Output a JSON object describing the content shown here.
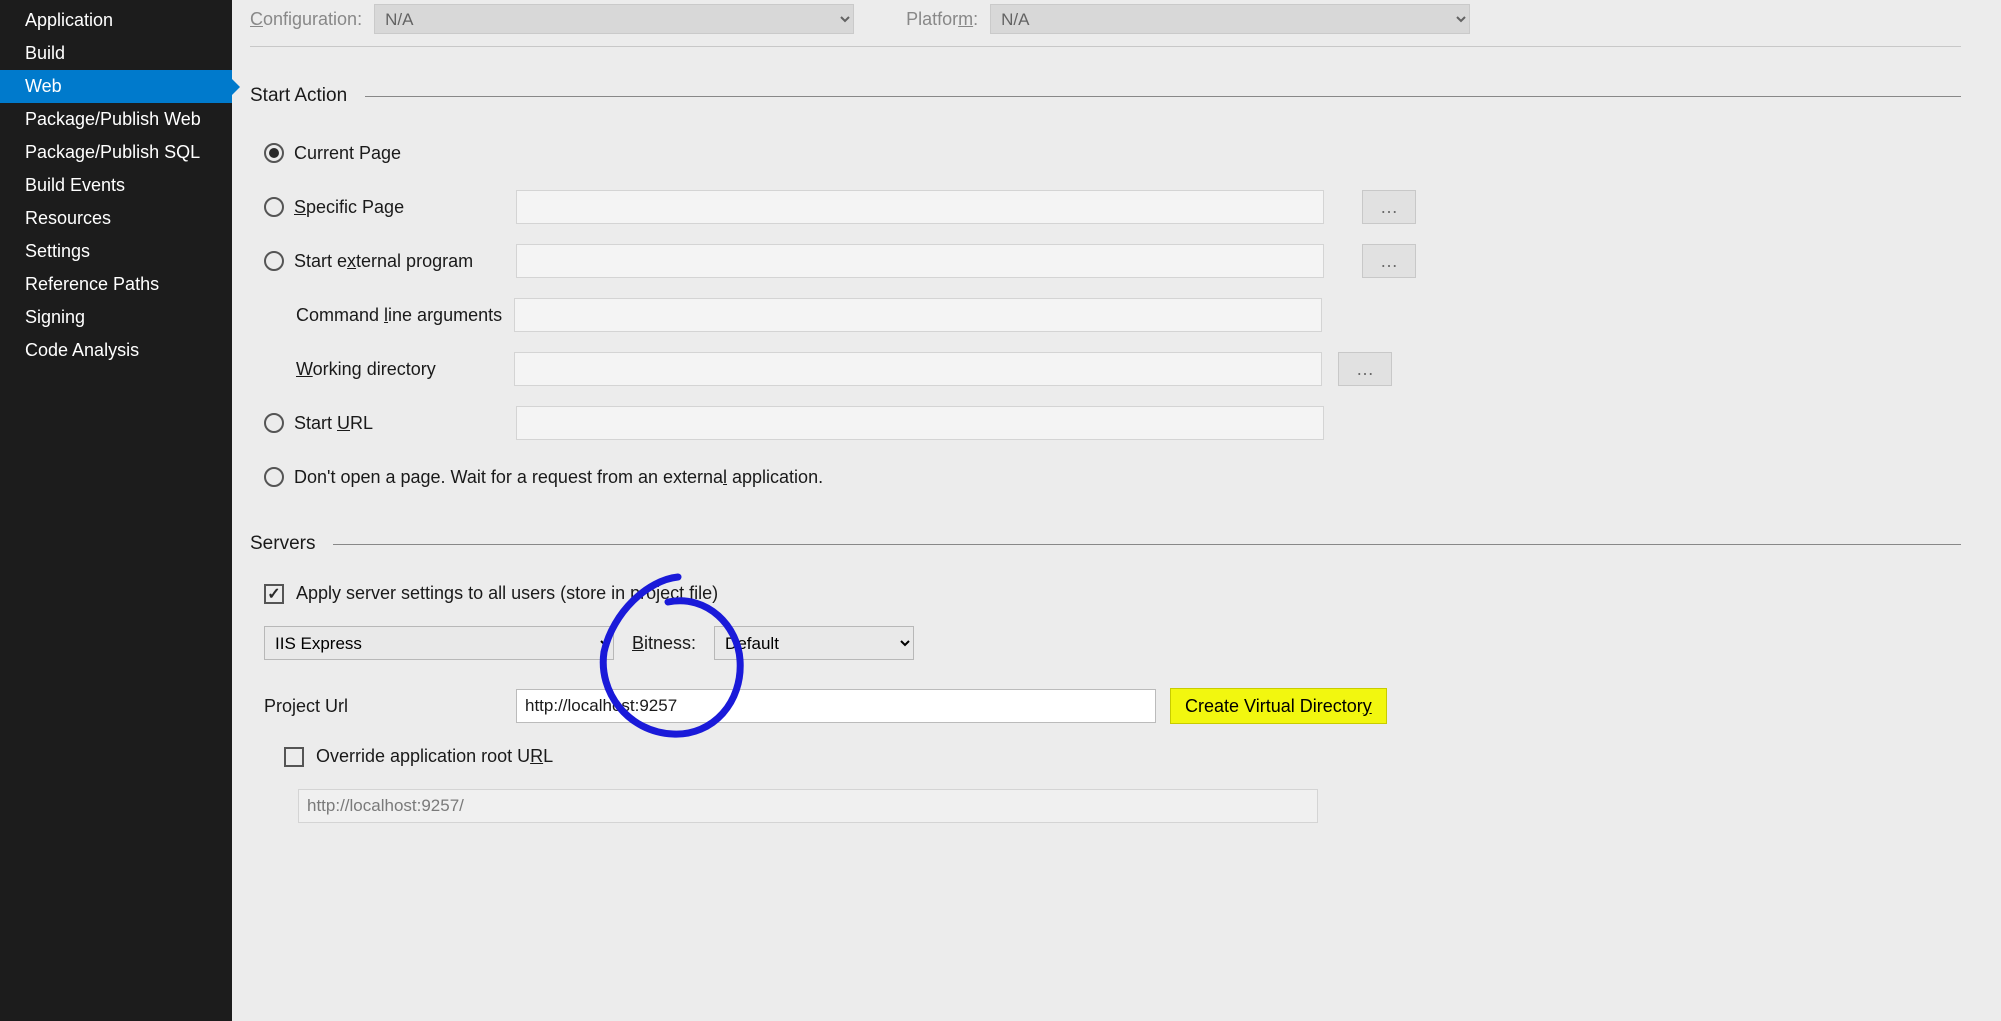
{
  "sidebar": {
    "items": [
      {
        "label": "Application"
      },
      {
        "label": "Build"
      },
      {
        "label": "Web"
      },
      {
        "label": "Package/Publish Web"
      },
      {
        "label": "Package/Publish SQL"
      },
      {
        "label": "Build Events"
      },
      {
        "label": "Resources"
      },
      {
        "label": "Settings"
      },
      {
        "label": "Reference Paths"
      },
      {
        "label": "Signing"
      },
      {
        "label": "Code Analysis"
      }
    ],
    "selected_index": 2
  },
  "top": {
    "configuration_label": "Configuration:",
    "configuration_value": "N/A",
    "platform_label": "Platform:",
    "platform_value": "N/A"
  },
  "start_action": {
    "header": "Start Action",
    "current_page": "Current Page",
    "specific_page": "Specific Page",
    "start_external": "Start external program",
    "cmd_args": "Command line arguments",
    "working_dir": "Working directory",
    "start_url": "Start URL",
    "dont_open": "Don't open a page.  Wait for a request from an external application.",
    "browse": "…"
  },
  "servers": {
    "header": "Servers",
    "apply_label": "Apply server settings to all users (store in project file)",
    "server_value": "IIS Express",
    "bitness_label": "Bitness:",
    "bitness_value": "Default",
    "project_url_label": "Project Url",
    "project_url_value": "http://localhost:9257",
    "cvd_label": "Create Virtual Directory",
    "override_label": "Override application root URL",
    "override_value": "http://localhost:9257/"
  }
}
